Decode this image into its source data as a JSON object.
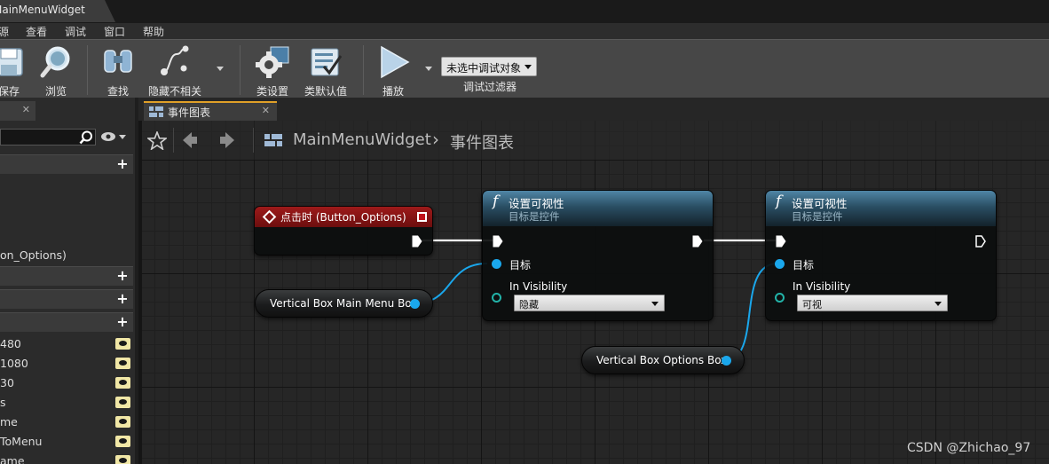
{
  "tab": {
    "title": "MainMenuWidget"
  },
  "menu": [
    "源",
    "查看",
    "调试",
    "窗口",
    "帮助"
  ],
  "toolbar": {
    "save": "保存",
    "browse": "浏览",
    "find": "查找",
    "hide_unrelated": "隐藏不相关",
    "class_settings": "类设置",
    "class_defaults": "类默认值",
    "play": "播放",
    "debug_object": "未选中调试对象",
    "debug_filter": "调试过滤器"
  },
  "left_panel": {
    "item_button_options": "on_Options)",
    "variables": [
      "480",
      "1080",
      "30",
      "s",
      "me",
      "ToMenu",
      "ame"
    ]
  },
  "graph_tab": {
    "title": "事件图表"
  },
  "breadcrumb": {
    "root": "MainMenuWidget",
    "separator": "›",
    "leaf": "事件图表"
  },
  "nodes": {
    "event": {
      "title": "点击时 (Button_Options)"
    },
    "setvis1": {
      "title": "设置可视性",
      "subtitle": "目标是控件",
      "target_label": "目标",
      "vis_label": "In Visibility",
      "vis_value": "隐藏"
    },
    "setvis2": {
      "title": "设置可视性",
      "subtitle": "目标是控件",
      "target_label": "目标",
      "vis_label": "In Visibility",
      "vis_value": "可视"
    },
    "var_main": {
      "label": "Vertical Box Main Menu Box"
    },
    "var_options": {
      "label": "Vertical Box Options Box"
    }
  },
  "colors": {
    "object_pin": "#1aa7ec",
    "enum_pin": "#22b3a8",
    "event_header": "#9e1a1a",
    "function_header": "#4f86a6"
  },
  "watermark": "CSDN @Zhichao_97"
}
